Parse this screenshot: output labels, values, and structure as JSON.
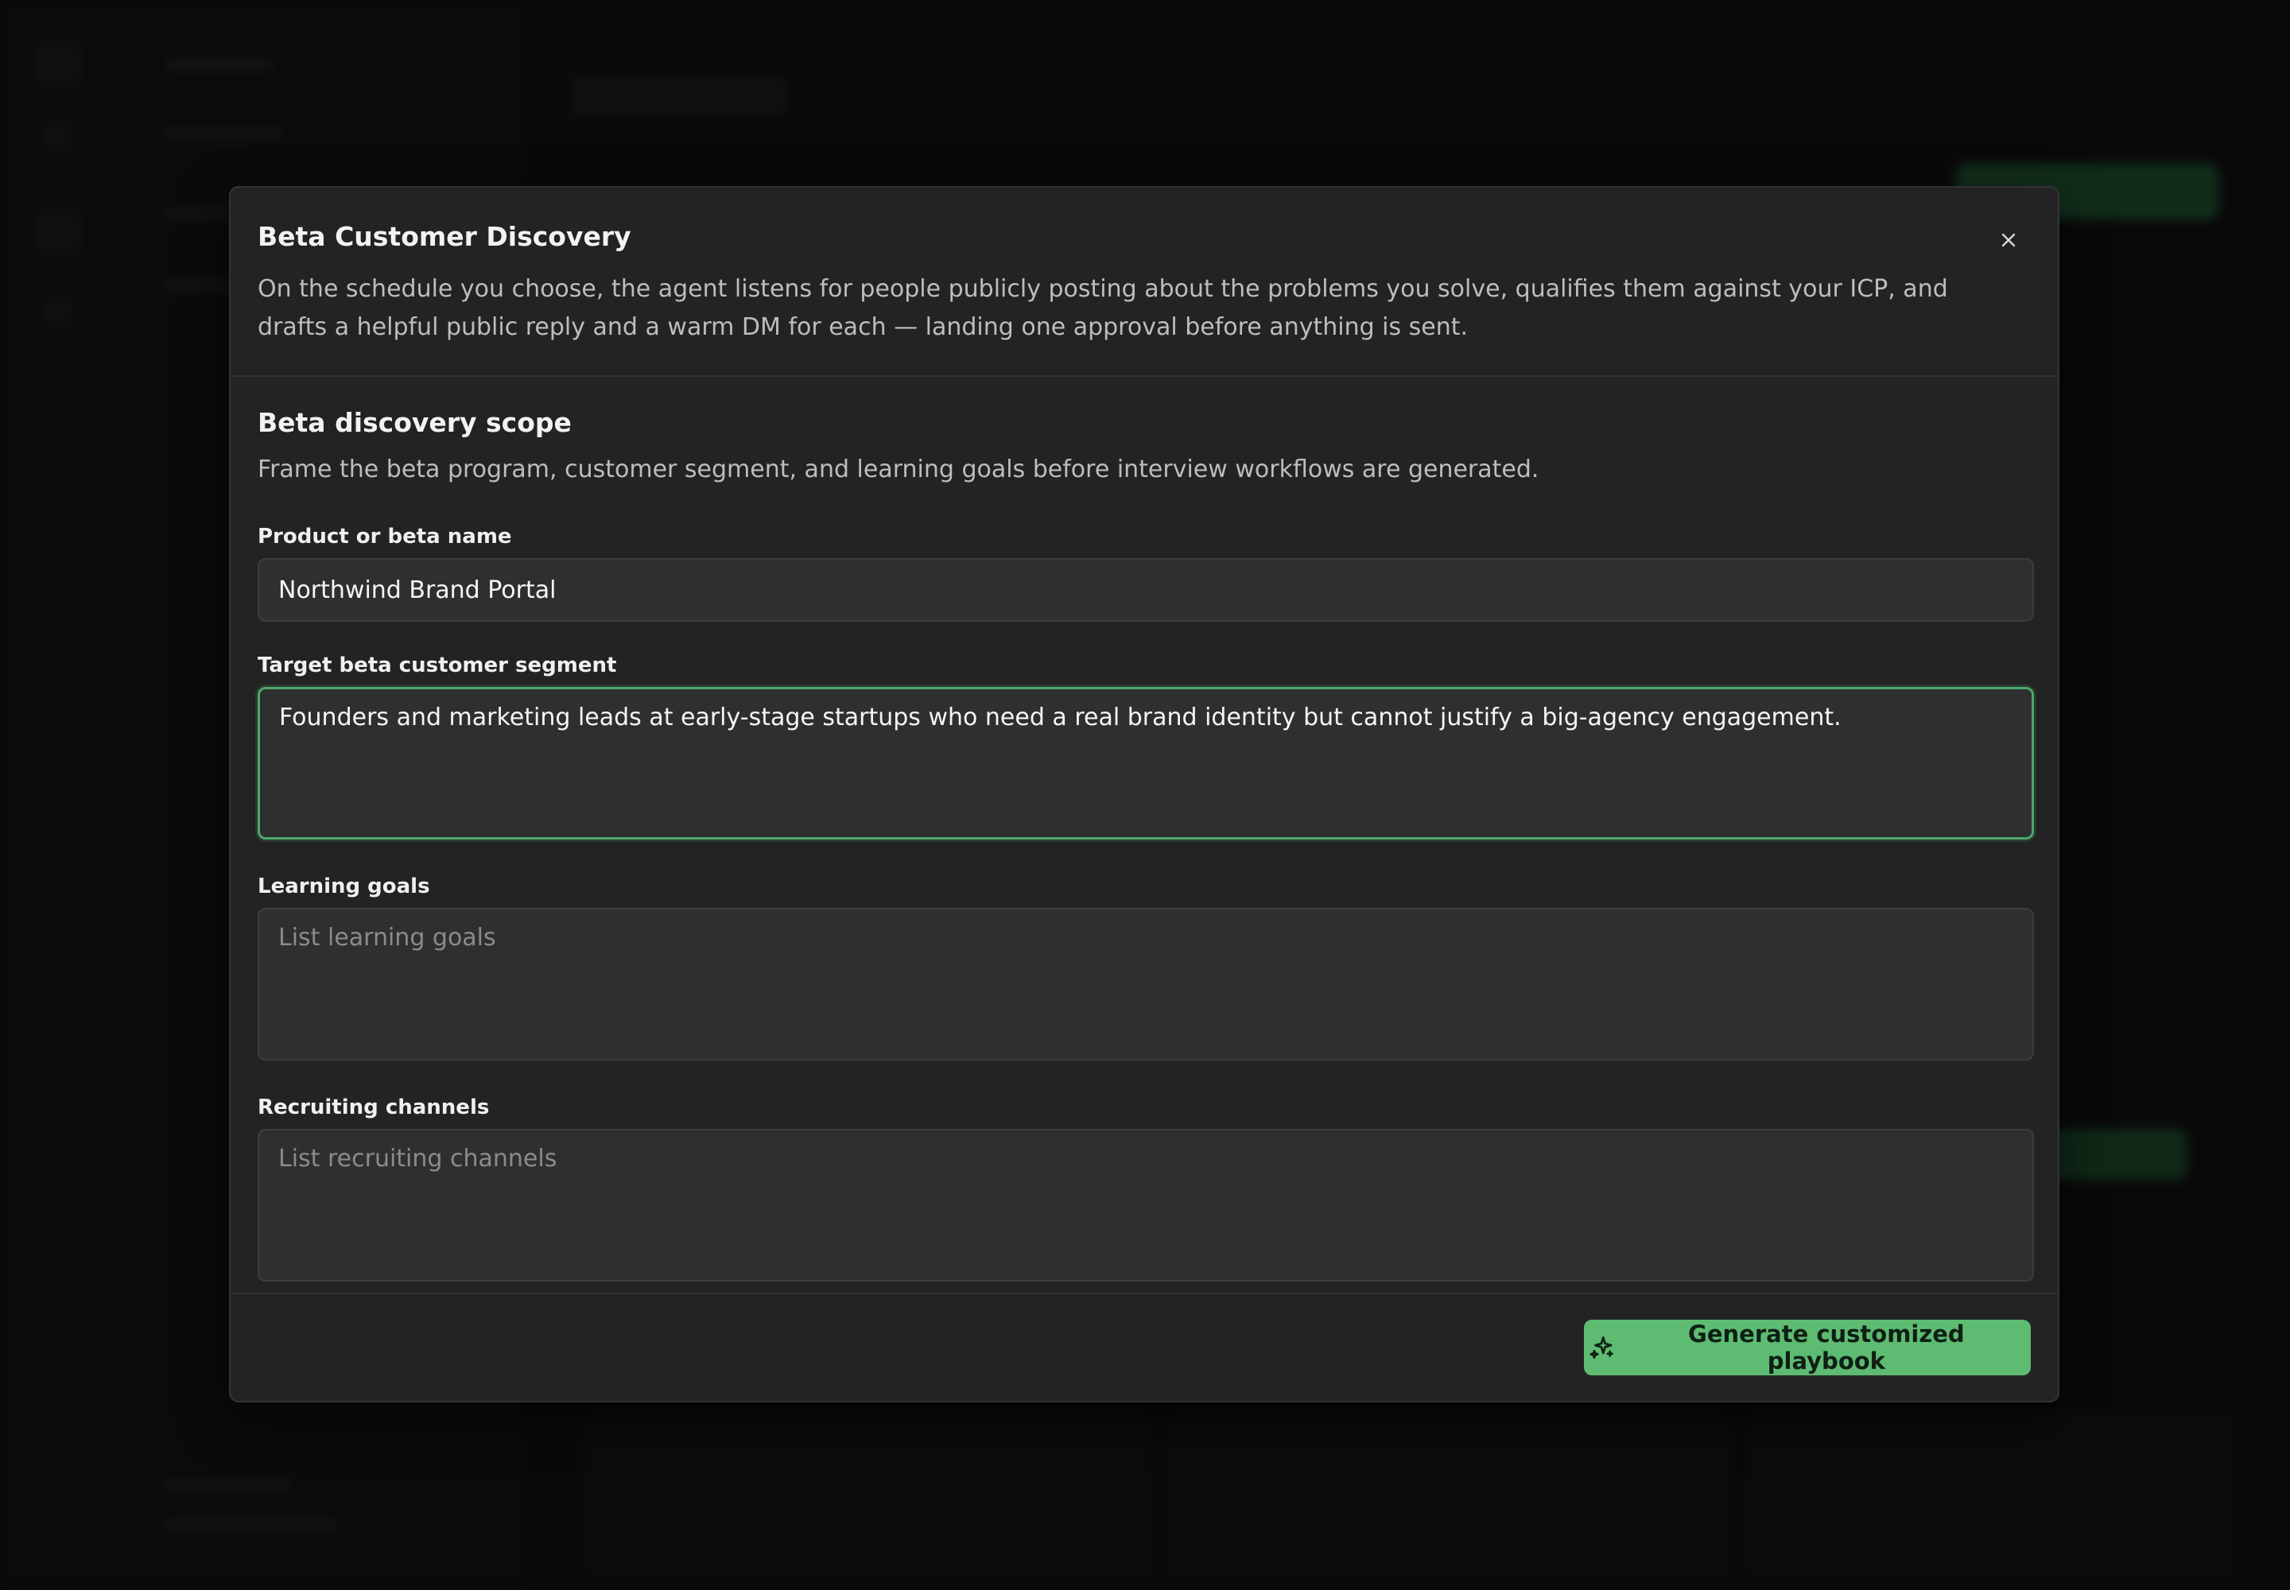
{
  "modal": {
    "title": "Beta Customer Discovery",
    "description": "On the schedule you choose, the agent listens for people publicly posting about the problems you solve, qualifies them against your ICP, and drafts a helpful public reply and a warm DM for each — landing one approval before anything is sent.",
    "close_icon": "close-icon"
  },
  "section": {
    "title": "Beta discovery scope",
    "description": "Frame the beta program, customer segment, and learning goals before interview workflows are generated."
  },
  "fields": {
    "product_name": {
      "label": "Product or beta name",
      "value": "Northwind Brand Portal"
    },
    "target_segment": {
      "label": "Target beta customer segment",
      "value": "Founders and marketing leads at early-stage startups who need a real brand identity but cannot justify a big-agency engagement."
    },
    "learning_goals": {
      "label": "Learning goals",
      "value": "",
      "placeholder": "List learning goals"
    },
    "recruiting_channels": {
      "label": "Recruiting channels",
      "value": "",
      "placeholder": "List recruiting channels"
    }
  },
  "footer": {
    "generate_label": "Generate customized playbook",
    "generate_icon": "sparkles-icon"
  },
  "colors": {
    "accent": "#5dbb72",
    "focus_border": "#4ea868",
    "modal_bg": "#232323"
  }
}
